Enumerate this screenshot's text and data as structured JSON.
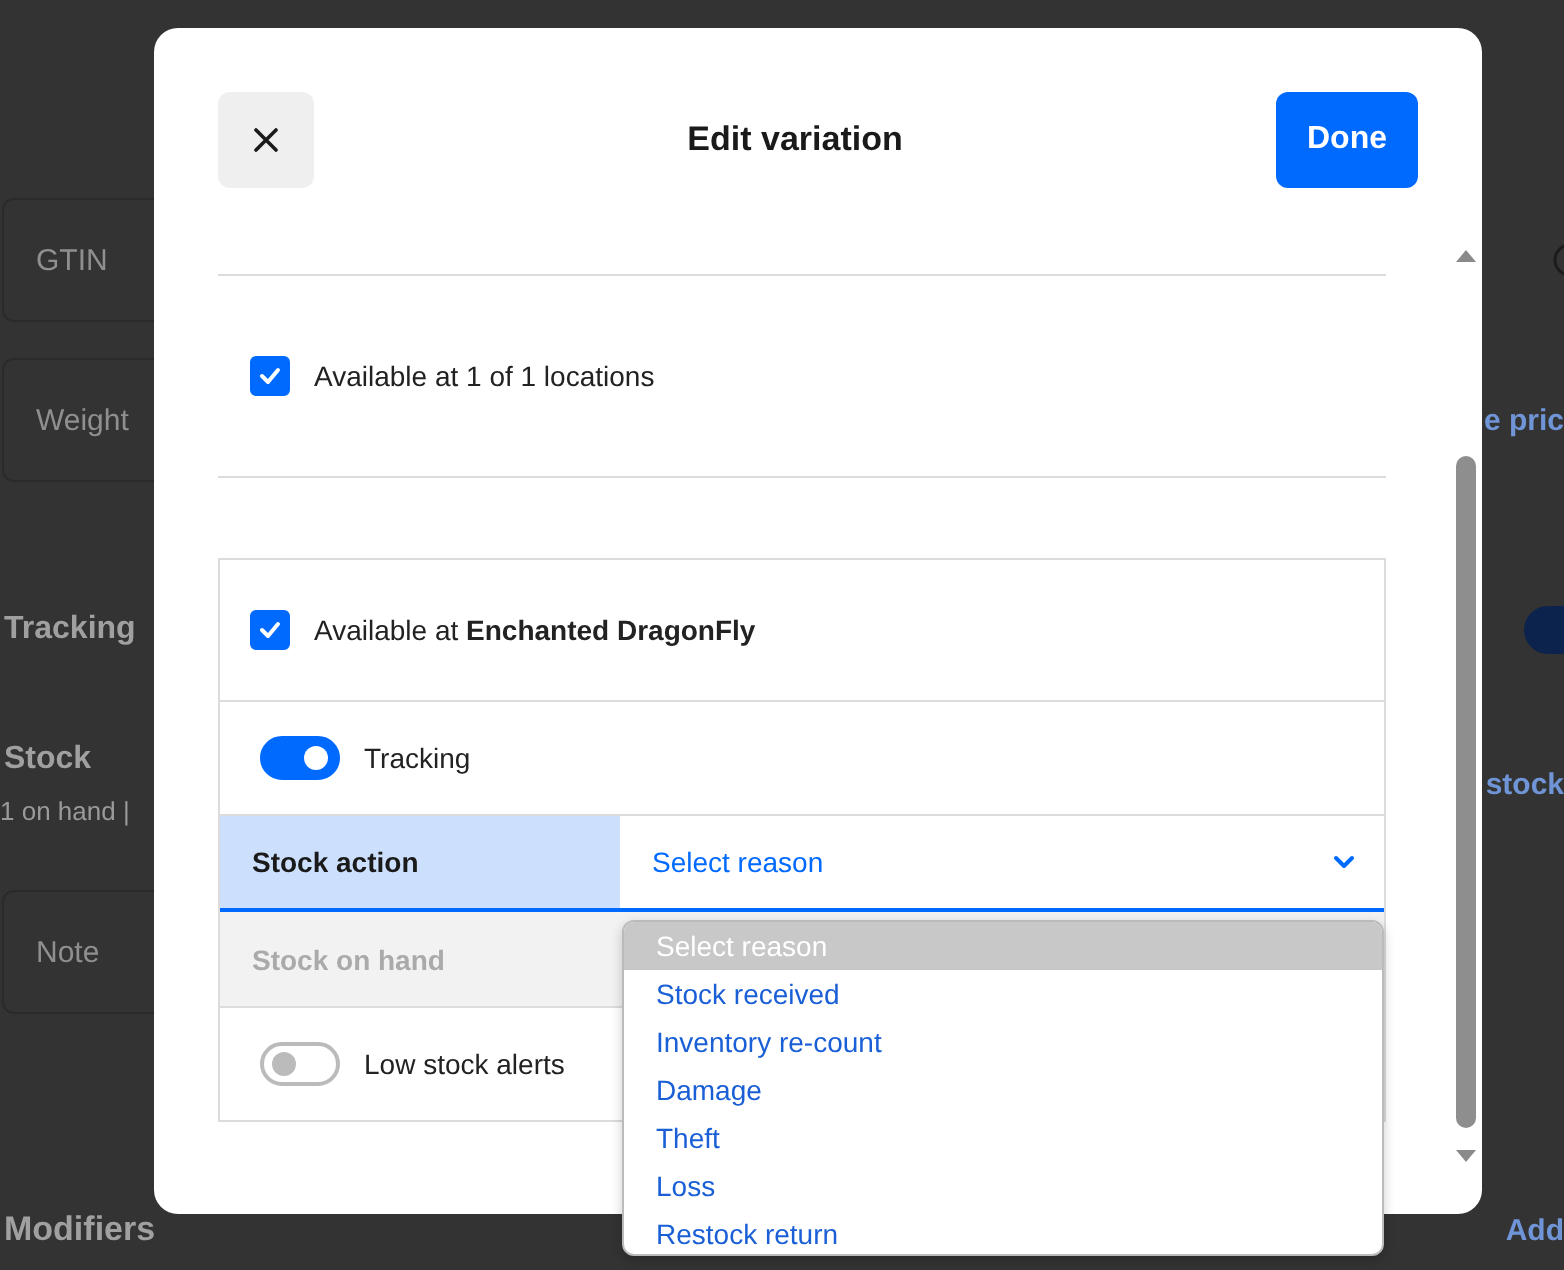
{
  "background": {
    "rows": [
      {
        "kind": "info_field",
        "label": "GTIN"
      },
      {
        "kind": "field",
        "label": "Weight",
        "link": "e pric"
      },
      {
        "kind": "toggle_section",
        "label": "Tracking",
        "on": true
      },
      {
        "kind": "section",
        "label": "Stock",
        "sub": "1 on hand |",
        "link": "stock"
      },
      {
        "kind": "field",
        "label": "Note"
      },
      {
        "kind": "footer_section",
        "label": "Modifiers",
        "link": "Add"
      }
    ]
  },
  "dialog": {
    "title": "Edit variation",
    "done": "Done",
    "locations": {
      "label": "Available at 1 of 1 locations",
      "checked": true
    },
    "location_card": {
      "available": {
        "label": "Available at **Enchanted DragonFly**",
        "checked": true
      },
      "rows": [
        {
          "kind": "toggle",
          "label": "Tracking",
          "on": true
        },
        {
          "kind": "select",
          "label": "Stock action",
          "value": "Select reason",
          "focused": true
        },
        {
          "kind": "readonly",
          "label": "Stock on hand",
          "disabled": true
        },
        {
          "kind": "toggle",
          "label": "Low stock alerts",
          "on": false
        }
      ]
    },
    "dropdown": {
      "options": [
        {
          "label": "Select reason",
          "selected": true
        },
        {
          "label": "Stock received",
          "selected": false
        },
        {
          "label": "Inventory re-count",
          "selected": false
        },
        {
          "label": "Damage",
          "selected": false
        },
        {
          "label": "Theft",
          "selected": false
        },
        {
          "label": "Loss",
          "selected": false
        },
        {
          "label": "Restock return",
          "selected": false
        }
      ]
    }
  }
}
